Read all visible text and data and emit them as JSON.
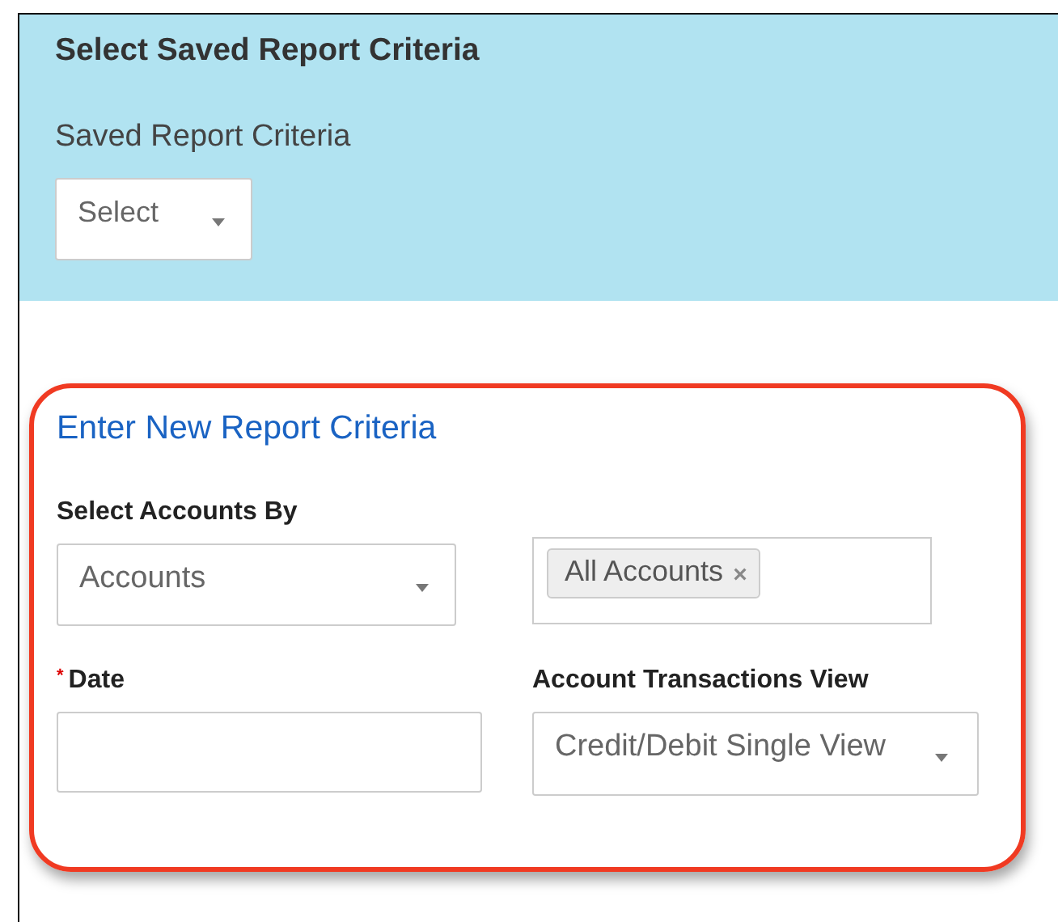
{
  "saved_criteria": {
    "title": "Select Saved Report Criteria",
    "label": "Saved Report Criteria",
    "select": {
      "value": "Select"
    }
  },
  "new_criteria": {
    "heading": "Enter New Report Criteria",
    "fields": [
      {
        "kind": "select",
        "label": "Select Accounts By",
        "required": false,
        "value": "Accounts"
      },
      {
        "kind": "tags",
        "tags": [
          "All Accounts"
        ],
        "remove": "×"
      },
      {
        "kind": "text",
        "label": "Date",
        "required": true,
        "required_mark": "*"
      },
      {
        "kind": "select",
        "label": "Account Transactions View",
        "required": false,
        "value": "Credit/Debit Single View"
      }
    ]
  }
}
